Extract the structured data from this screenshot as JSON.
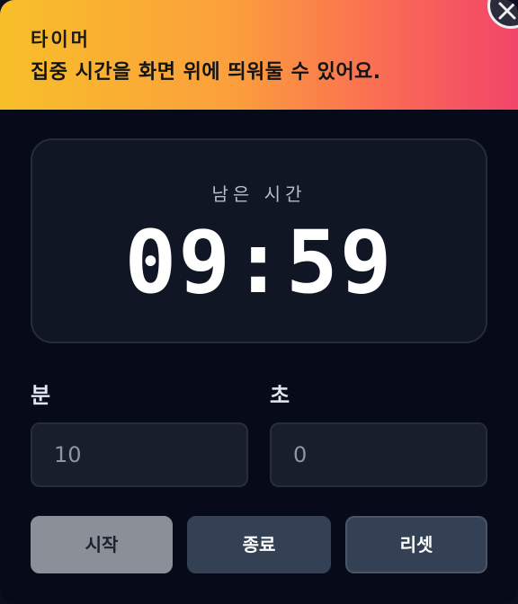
{
  "header": {
    "title": "타이머",
    "subtitle": "집중 시간을 화면 위에 띄워둘 수 있어요."
  },
  "close_icon": "close-icon",
  "timer": {
    "label": "남은 시간",
    "value": "09:59"
  },
  "minutes": {
    "label": "분",
    "placeholder": "10"
  },
  "seconds": {
    "label": "초",
    "placeholder": "0"
  },
  "buttons": {
    "start": "시작",
    "stop": "종료",
    "reset": "리셋"
  },
  "colors": {
    "header_gradient_start": "#f8bf2a",
    "header_gradient_end": "#f1456a",
    "background": "#070b19",
    "card": "#111624"
  }
}
